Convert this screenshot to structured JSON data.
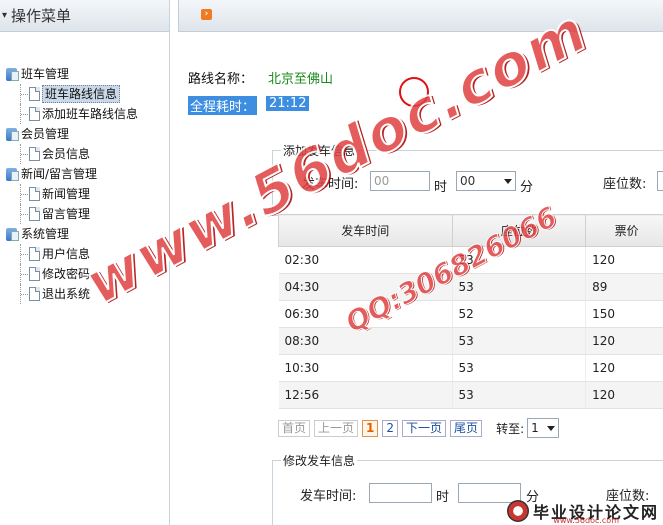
{
  "sidebar": {
    "title": "操作菜单",
    "groups": [
      {
        "label": "班车管理",
        "items": [
          "班车路线信息",
          "添加班车路线信息"
        ]
      },
      {
        "label": "会员管理",
        "items": [
          "会员信息"
        ]
      },
      {
        "label": "新闻/留言管理",
        "items": [
          "新闻管理",
          "留言管理"
        ]
      },
      {
        "label": "系统管理",
        "items": [
          "用户信息",
          "修改密码",
          "退出系统"
        ]
      }
    ]
  },
  "route": {
    "name_label": "路线名称：",
    "name_value": "北京至佛山",
    "duration_label": "全程耗时：",
    "duration_value": "21:12"
  },
  "add_form": {
    "legend": "添加发车信息",
    "time_label": "发车时间:",
    "hour_value": "00",
    "hour_unit": "时",
    "minute_value": "00",
    "minute_unit": "分",
    "seats_label": "座位数:"
  },
  "table": {
    "headers": [
      "发车时间",
      "座位数",
      "票价"
    ],
    "rows": [
      [
        "02:30",
        "53",
        "120"
      ],
      [
        "04:30",
        "53",
        "89"
      ],
      [
        "06:30",
        "52",
        "150"
      ],
      [
        "08:30",
        "53",
        "120"
      ],
      [
        "10:30",
        "53",
        "120"
      ],
      [
        "12:56",
        "53",
        "120"
      ]
    ]
  },
  "pager": {
    "first": "首页",
    "prev": "上一页",
    "pages": [
      "1",
      "2"
    ],
    "current": "1",
    "next": "下一页",
    "last": "尾页",
    "goto_label": "转至:",
    "goto_value": "1"
  },
  "edit_form": {
    "legend": "修改发车信息",
    "time_label": "发车时间:",
    "hour_unit": "时",
    "minute_unit": "分",
    "seats_label": "座位数:"
  },
  "watermarks": {
    "site": "www.56doc.com",
    "qq": "QQ:306826066",
    "logo_text": "毕业设计论文网",
    "logo_url": "www.56doc.com"
  },
  "colors": {
    "route_value": "#1a8a1a",
    "highlight": "#3d8ee0",
    "watermark": "#e04040",
    "marker_circle": "#e01010"
  }
}
